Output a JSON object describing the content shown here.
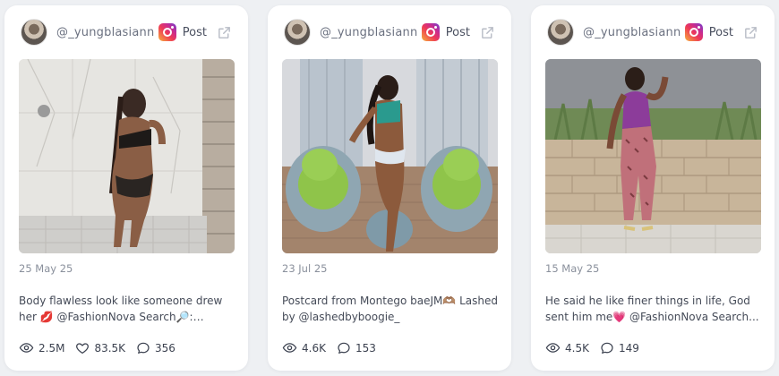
{
  "cards": [
    {
      "username": "@_yungblasiann",
      "post_label": "Post",
      "date": "25 May 25",
      "caption": "Body flawless look like someone drew her 💋 @FashionNova Search🔎: Dayclub...",
      "views": "2.5M",
      "likes": "83.5K",
      "comments": "356"
    },
    {
      "username": "@_yungblasiann",
      "post_label": "Post",
      "date": "23 Jul 25",
      "caption": "Postcard from Montego baeJM🫶🏽 Lashed by @lashedbyboogie_",
      "views": "4.6K",
      "comments": "153"
    },
    {
      "username": "@_yungblasiann",
      "post_label": "Post",
      "date": "15 May 25",
      "caption": "He said he like finer things in life, God sent him me💗 @FashionNova Search...",
      "views": "4.5K",
      "comments": "149"
    }
  ],
  "icons": {
    "platform": "instagram-icon",
    "open": "external-link-icon",
    "views": "eye-icon",
    "likes": "heart-icon",
    "comments": "comment-icon"
  },
  "colors": {
    "background": "#eef0f3",
    "card": "#ffffff",
    "muted_text": "#8a909c"
  }
}
